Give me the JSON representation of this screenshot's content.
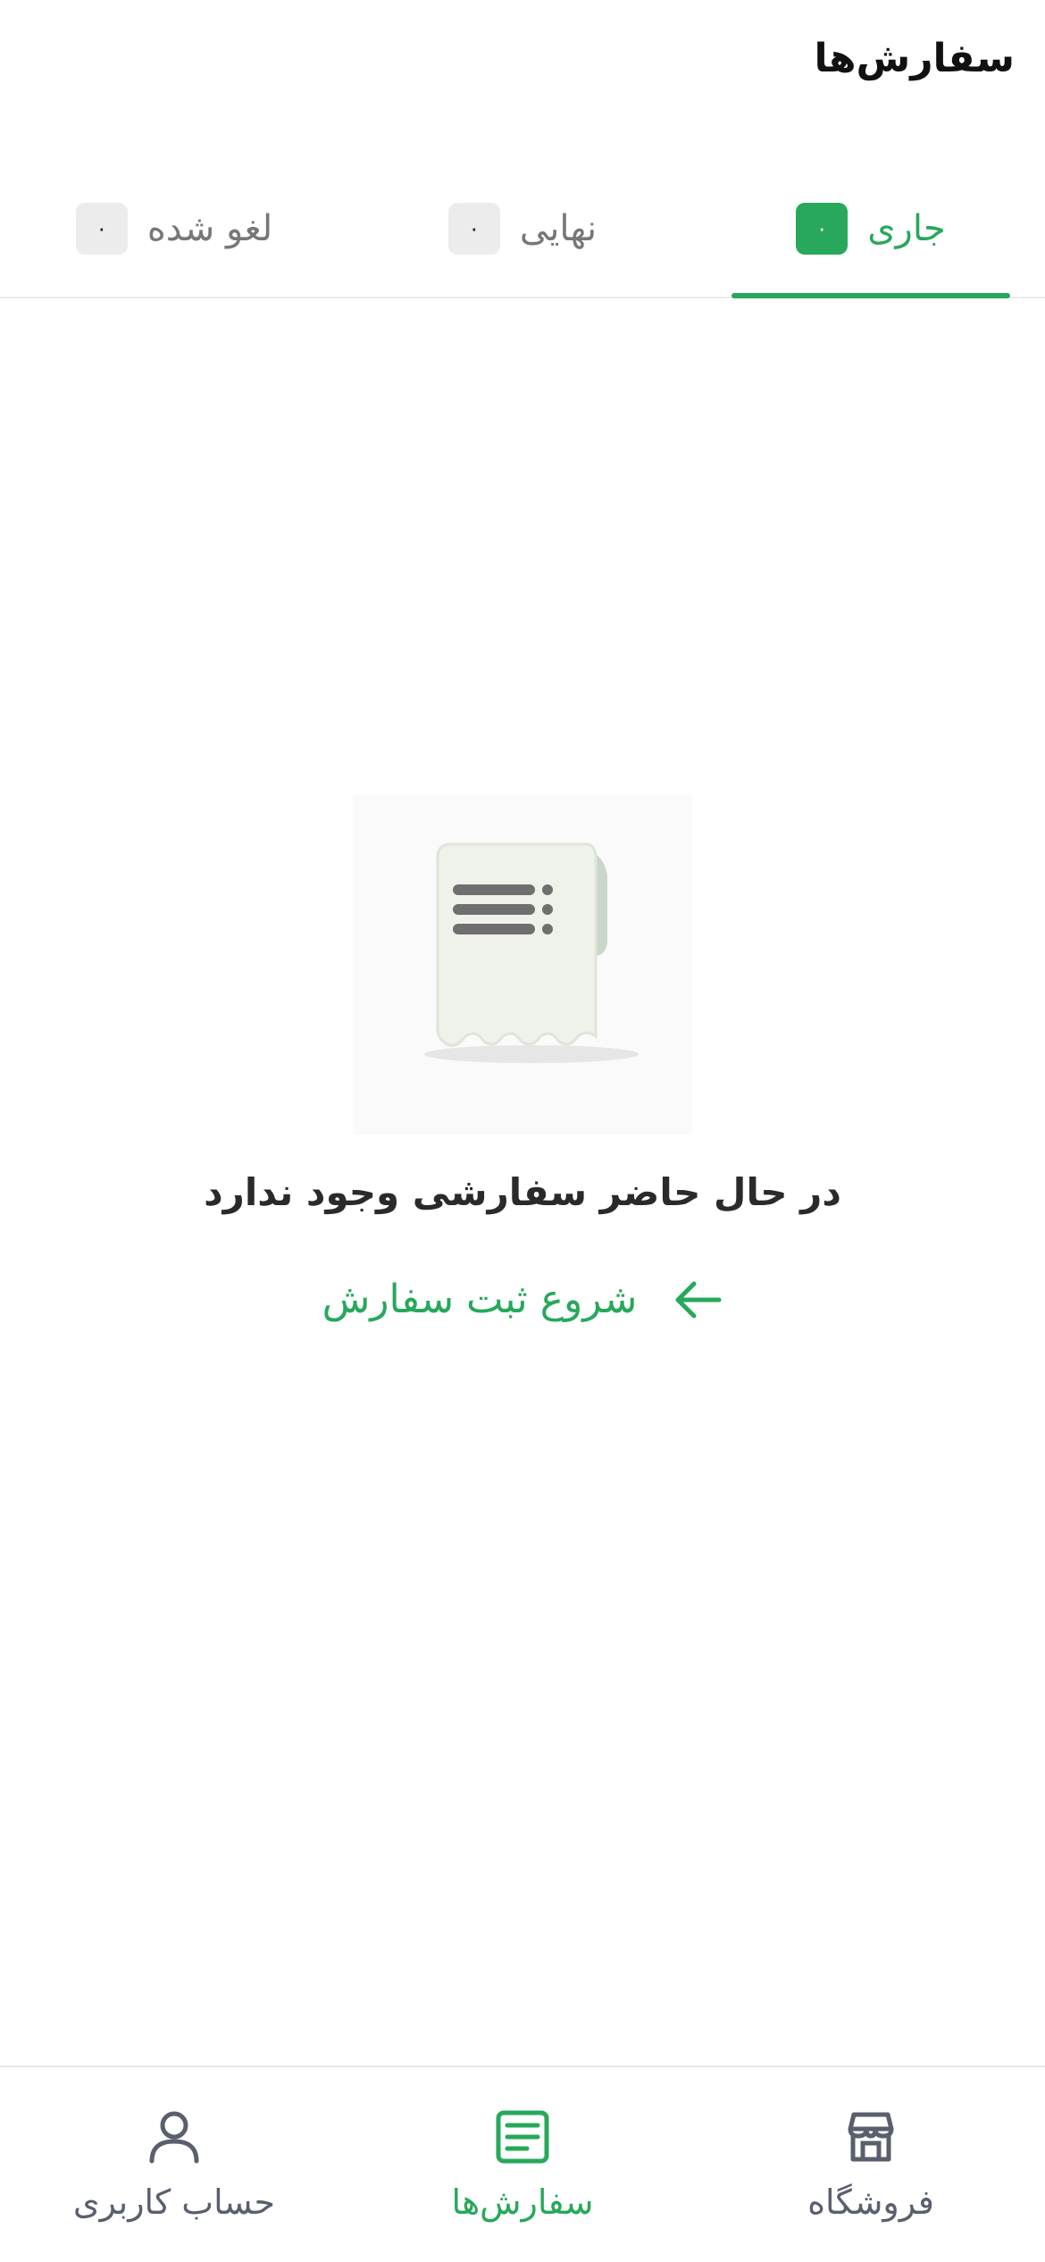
{
  "header": {
    "title": "سفارش‌ها"
  },
  "tabs": [
    {
      "label": "جاری",
      "count": "۰",
      "active": true
    },
    {
      "label": "نهایی",
      "count": "۰",
      "active": false
    },
    {
      "label": "لغو شده",
      "count": "۰",
      "active": false
    }
  ],
  "empty_state": {
    "illustration": "receipt-icon",
    "message": "در حال حاضر سفارشی وجود ندارد",
    "action_label": "شروع ثبت سفارش",
    "action_icon": "arrow-left-icon"
  },
  "bottom_nav": [
    {
      "label": "فروشگاه",
      "icon": "store-icon",
      "active": false
    },
    {
      "label": "سفارش‌ها",
      "icon": "orders-icon",
      "active": true
    },
    {
      "label": "حساب کاربری",
      "icon": "user-icon",
      "active": false
    }
  ],
  "colors": {
    "accent": "#27a85a",
    "badge_inactive": "#ececec",
    "nav_inactive": "#5a5f6e"
  }
}
